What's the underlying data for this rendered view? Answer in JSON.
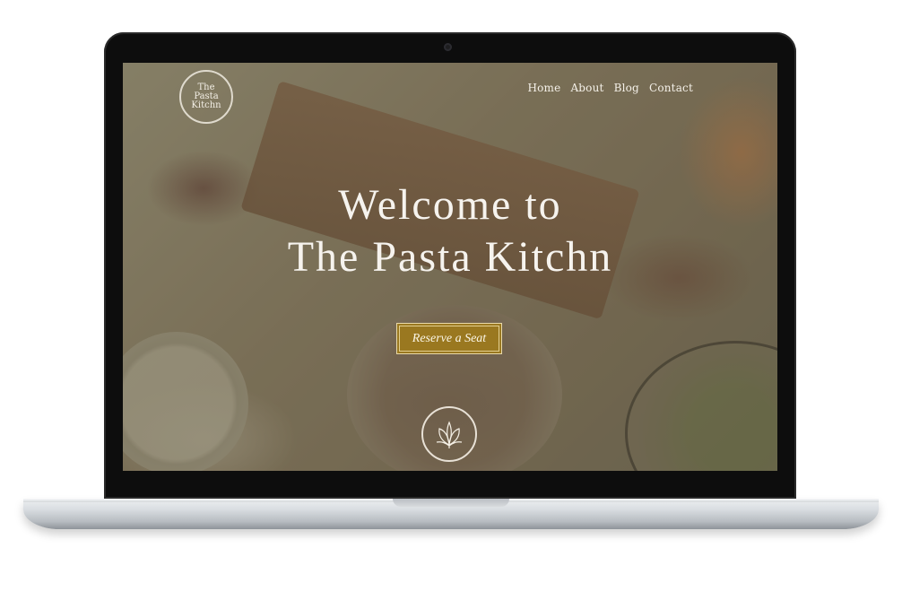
{
  "logo": {
    "line1": "The",
    "line2": "Pasta",
    "line3": "Kitchn"
  },
  "nav": {
    "items": [
      {
        "label": "Home"
      },
      {
        "label": "About"
      },
      {
        "label": "Blog"
      },
      {
        "label": "Contact"
      }
    ]
  },
  "hero": {
    "title_line1": "Welcome to",
    "title_line2": "The Pasta Kitchn",
    "cta_label": "Reserve a Seat"
  },
  "emblem": {
    "icon": "leaf-emblem-icon"
  },
  "colors": {
    "accent": "#9a7820",
    "text": "#f6f3ee"
  }
}
